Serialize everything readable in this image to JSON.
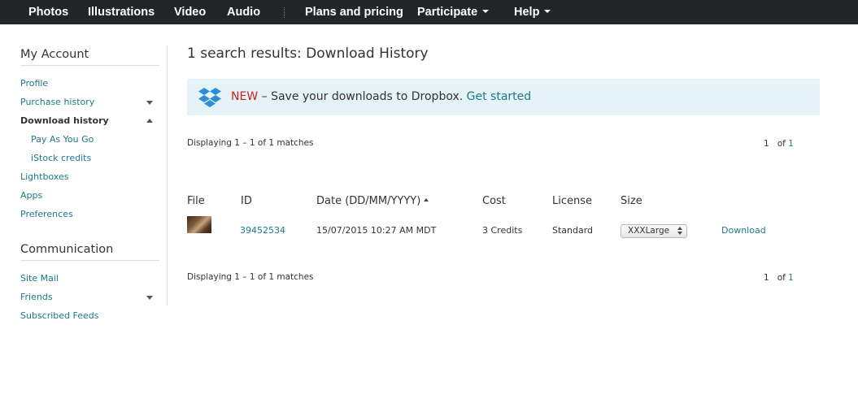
{
  "nav": {
    "photos": "Photos",
    "illustrations": "Illustrations",
    "video": "Video",
    "audio": "Audio",
    "plans": "Plans and pricing",
    "participate": "Participate",
    "help": "Help"
  },
  "sidebar": {
    "account_heading": "My Account",
    "items": [
      {
        "label": "Profile"
      },
      {
        "label": "Purchase history"
      },
      {
        "label": "Download history"
      },
      {
        "label": "Pay As You Go"
      },
      {
        "label": "iStock credits"
      },
      {
        "label": "Lightboxes"
      },
      {
        "label": "Apps"
      },
      {
        "label": "Preferences"
      }
    ],
    "communication_heading": "Communication",
    "comm_items": [
      {
        "label": "Site Mail"
      },
      {
        "label": "Friends"
      },
      {
        "label": "Subscribed Feeds"
      }
    ]
  },
  "main": {
    "title": "1 search results: Download History",
    "banner": {
      "new_label": "NEW",
      "message": " – Save your downloads to Dropbox. ",
      "cta": "Get started",
      "icon": "dropbox-icon",
      "icon_color": "#2a8fd6"
    },
    "displaying": "Displaying 1 – 1 of 1 matches",
    "pager": {
      "current": "1",
      "of_label": "of",
      "total": "1"
    },
    "columns": {
      "file": "File",
      "id": "ID",
      "date": "Date (DD/MM/YYYY)",
      "cost": "Cost",
      "license": "License",
      "size": "Size"
    },
    "row": {
      "id": "39452534",
      "date": "15/07/2015 10:27 AM MDT",
      "cost": "3 Credits",
      "license": "Standard",
      "size": "XXXLarge",
      "action": "Download"
    }
  },
  "colors": {
    "nav_bg": "#222629",
    "link": "#1b7a8c",
    "new_red": "#cc1f1f",
    "banner_bg": "#e5f3f8"
  }
}
